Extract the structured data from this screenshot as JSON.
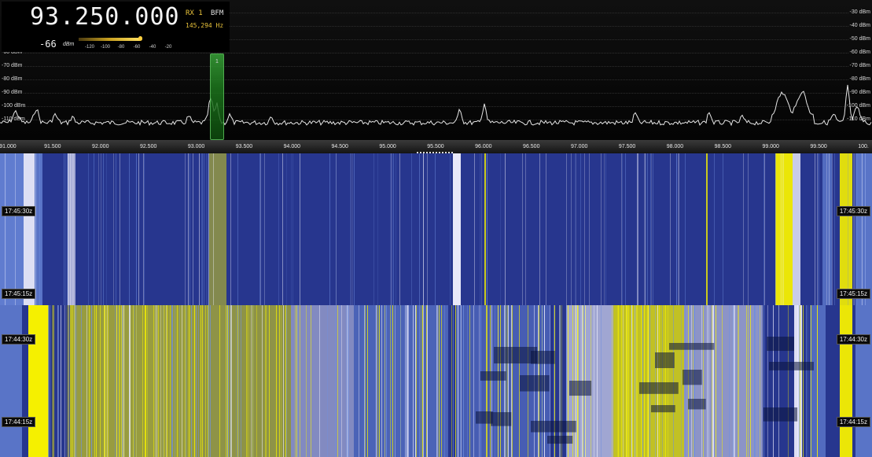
{
  "readout": {
    "frequency": "93.250.000",
    "rx_label": "RX 1",
    "mode": "BFM",
    "offset": "145,294 Hz",
    "level": "-66",
    "level_unit": "dBm",
    "meter_scale": [
      "-120",
      "-100",
      "-80",
      "-60",
      "-40",
      "-20"
    ],
    "meter_level_fraction": 0.56
  },
  "spectrum": {
    "db_labels": [
      "-30 dBm",
      "-40 dBm",
      "-50 dBm",
      "-60 dBm",
      "-70 dBm",
      "-80 dBm",
      "-90 dBm",
      "-100 dBm",
      "-110 dBm"
    ],
    "trace_color": "#e6e6e6"
  },
  "vfo": {
    "number": "1",
    "color": "#2e9e2e"
  },
  "axis": {
    "ticks": [
      "91.000",
      "91.500",
      "92.000",
      "92.500",
      "93.000",
      "93.500",
      "94.000",
      "94.500",
      "95.000",
      "95.500",
      "96.000",
      "96.500",
      "97.000",
      "97.500",
      "98.000",
      "98.500",
      "99.000",
      "99.500",
      "100."
    ]
  },
  "waterfall": {
    "time_labels": [
      "17:45:30z",
      "17:45:15z",
      "17:44:30z",
      "17:44:15z"
    ],
    "colors": {
      "background": "#27368e",
      "mid": "#6f8fe0",
      "high": "#f2f2ff",
      "peak": "#f5f000"
    }
  }
}
